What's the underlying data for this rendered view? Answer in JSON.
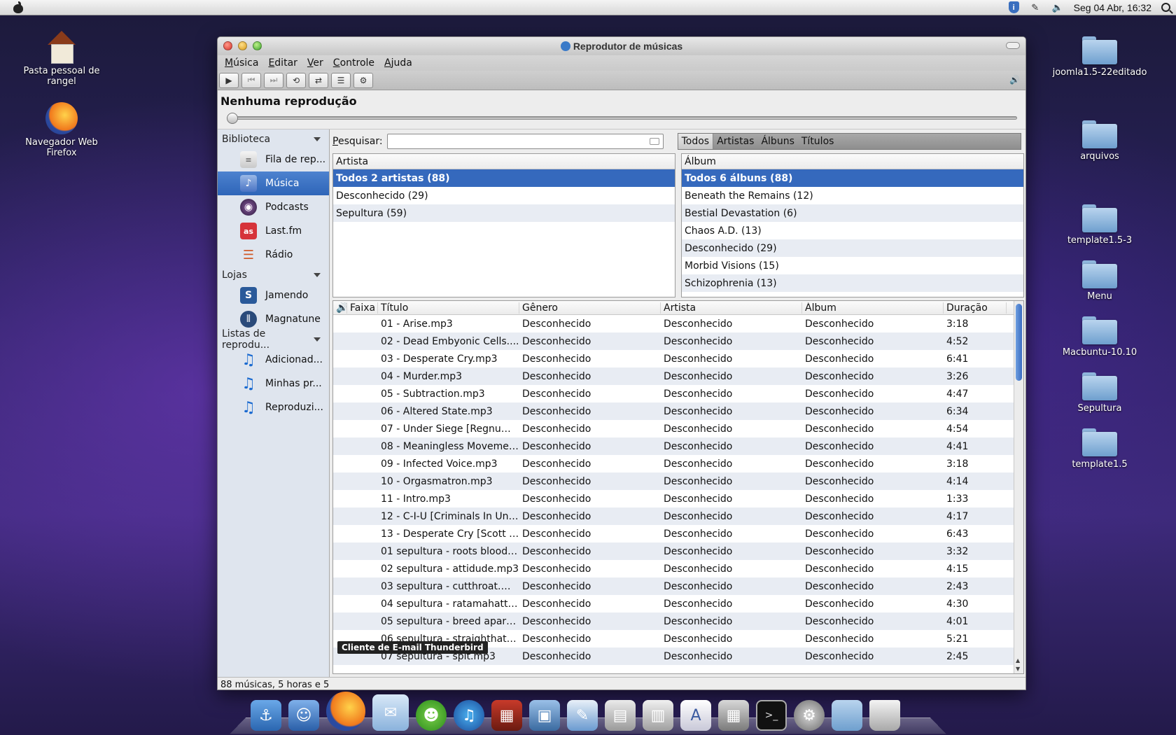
{
  "menubar": {
    "clock": "Seg 04 Abr, 16:32"
  },
  "desktop_left": [
    {
      "label": "Pasta pessoal de rangel",
      "icon": "home-folder-icon"
    },
    {
      "label": "Navegador Web Firefox",
      "icon": "firefox-icon"
    }
  ],
  "desktop_right": [
    {
      "label": "joomla1.5-22editado"
    },
    {
      "label": "arquivos"
    },
    {
      "label": "template1.5-3"
    },
    {
      "label": "Menu"
    },
    {
      "label": "Macbuntu-10.10"
    },
    {
      "label": "Sepultura"
    },
    {
      "label": "template1.5"
    }
  ],
  "window": {
    "title": "Reprodutor de músicas",
    "menus": [
      "Música",
      "Editar",
      "Ver",
      "Controle",
      "Ajuda"
    ],
    "now_playing": "Nenhuma reprodução",
    "seek_position": 0
  },
  "sidebar": {
    "sections": [
      {
        "title": "Biblioteca",
        "items": [
          {
            "label": "Fila de rep...",
            "icon": "queue-icon",
            "active": false
          },
          {
            "label": "Música",
            "icon": "music-library-icon",
            "active": true
          },
          {
            "label": "Podcasts",
            "icon": "podcast-icon",
            "active": false
          },
          {
            "label": "Last.fm",
            "icon": "lastfm-icon",
            "active": false
          },
          {
            "label": "Rádio",
            "icon": "radio-icon",
            "active": false
          }
        ]
      },
      {
        "title": "Lojas",
        "items": [
          {
            "label": "Jamendo",
            "icon": "jamendo-icon",
            "active": false
          },
          {
            "label": "Magnatune",
            "icon": "magnatune-icon",
            "active": false
          }
        ]
      },
      {
        "title": "Listas de reprodu...",
        "items": [
          {
            "label": "Adicionad...",
            "icon": "playlist-note-icon",
            "active": false
          },
          {
            "label": "Minhas pr...",
            "icon": "playlist-note-icon",
            "active": false
          },
          {
            "label": "Reproduzi...",
            "icon": "playlist-note-icon",
            "active": false
          }
        ]
      }
    ]
  },
  "search": {
    "label": "Pesquisar:",
    "value": "",
    "placeholder": ""
  },
  "filter_tabs": [
    {
      "label": "Todos",
      "active": true
    },
    {
      "label": "Artistas",
      "active": false
    },
    {
      "label": "Álbuns",
      "active": false
    },
    {
      "label": "Títulos",
      "active": false
    }
  ],
  "artist_pane": {
    "header": "Artista",
    "rows": [
      {
        "label": "Todos 2 artistas (88)",
        "selected": true
      },
      {
        "label": "Desconhecido (29)",
        "selected": false
      },
      {
        "label": "Sepultura (59)",
        "selected": false
      }
    ]
  },
  "album_pane": {
    "header": "Álbum",
    "rows": [
      {
        "label": "Todos 6 álbuns (88)",
        "selected": true
      },
      {
        "label": "Beneath the Remains (12)",
        "selected": false
      },
      {
        "label": "Bestial Devastation (6)",
        "selected": false
      },
      {
        "label": "Chaos A.D. (13)",
        "selected": false
      },
      {
        "label": "Desconhecido (29)",
        "selected": false
      },
      {
        "label": "Morbid Visions (15)",
        "selected": false
      },
      {
        "label": "Schizophrenia (13)",
        "selected": false
      }
    ]
  },
  "tracks": {
    "columns": [
      "Faixa",
      "Título",
      "Gênero",
      "Artista",
      "Álbum",
      "Duração"
    ],
    "rows": [
      {
        "title": "01 - Arise.mp3",
        "genre": "Desconhecido",
        "artist": "Desconhecido",
        "album": "Desconhecido",
        "duration": "3:18"
      },
      {
        "title": "02 - Dead Embyonic Cells....",
        "genre": "Desconhecido",
        "artist": "Desconhecido",
        "album": "Desconhecido",
        "duration": "4:52"
      },
      {
        "title": "03 - Desperate Cry.mp3",
        "genre": "Desconhecido",
        "artist": "Desconhecido",
        "album": "Desconhecido",
        "duration": "6:41"
      },
      {
        "title": "04 - Murder.mp3",
        "genre": "Desconhecido",
        "artist": "Desconhecido",
        "album": "Desconhecido",
        "duration": "3:26"
      },
      {
        "title": "05 - Subtraction.mp3",
        "genre": "Desconhecido",
        "artist": "Desconhecido",
        "album": "Desconhecido",
        "duration": "4:47"
      },
      {
        "title": "06 - Altered State.mp3",
        "genre": "Desconhecido",
        "artist": "Desconhecido",
        "album": "Desconhecido",
        "duration": "6:34"
      },
      {
        "title": "07 - Under Siege [Regnum I...",
        "genre": "Desconhecido",
        "artist": "Desconhecido",
        "album": "Desconhecido",
        "duration": "4:54"
      },
      {
        "title": "08 - Meaningless Movemen...",
        "genre": "Desconhecido",
        "artist": "Desconhecido",
        "album": "Desconhecido",
        "duration": "4:41"
      },
      {
        "title": "09 - Infected Voice.mp3",
        "genre": "Desconhecido",
        "artist": "Desconhecido",
        "album": "Desconhecido",
        "duration": "3:18"
      },
      {
        "title": "10 - Orgasmatron.mp3",
        "genre": "Desconhecido",
        "artist": "Desconhecido",
        "album": "Desconhecido",
        "duration": "4:14"
      },
      {
        "title": "11 - Intro.mp3",
        "genre": "Desconhecido",
        "artist": "Desconhecido",
        "album": "Desconhecido",
        "duration": "1:33"
      },
      {
        "title": "12 - C-I-U [Criminals In Unif...",
        "genre": "Desconhecido",
        "artist": "Desconhecido",
        "album": "Desconhecido",
        "duration": "4:17"
      },
      {
        "title": "13 - Desperate Cry [Scott B...",
        "genre": "Desconhecido",
        "artist": "Desconhecido",
        "album": "Desconhecido",
        "duration": "6:43"
      },
      {
        "title": "01 sepultura - roots bloody ...",
        "genre": "Desconhecido",
        "artist": "Desconhecido",
        "album": "Desconhecido",
        "duration": "3:32"
      },
      {
        "title": "02 sepultura - attidude.mp3",
        "genre": "Desconhecido",
        "artist": "Desconhecido",
        "album": "Desconhecido",
        "duration": "4:15"
      },
      {
        "title": "03 sepultura - cutthroat.mp3",
        "genre": "Desconhecido",
        "artist": "Desconhecido",
        "album": "Desconhecido",
        "duration": "2:43"
      },
      {
        "title": "04 sepultura - ratamahatta....",
        "genre": "Desconhecido",
        "artist": "Desconhecido",
        "album": "Desconhecido",
        "duration": "4:30"
      },
      {
        "title": "05 sepultura - breed apart....",
        "genre": "Desconhecido",
        "artist": "Desconhecido",
        "album": "Desconhecido",
        "duration": "4:01"
      },
      {
        "title": "06 sepultura - straighthate....",
        "genre": "Desconhecido",
        "artist": "Desconhecido",
        "album": "Desconhecido",
        "duration": "5:21"
      },
      {
        "title": "07 sepultura - spit.mp3",
        "genre": "Desconhecido",
        "artist": "Desconhecido",
        "album": "Desconhecido",
        "duration": "2:45"
      }
    ]
  },
  "status": "88 músicas, 5 horas e 5",
  "tooltip": "Cliente de E-mail Thunderbird",
  "dock": [
    {
      "name": "dock-anchor-icon",
      "glyph": "⚓"
    },
    {
      "name": "dock-finder-icon",
      "glyph": "☺"
    },
    {
      "name": "dock-firefox-icon",
      "glyph": ""
    },
    {
      "name": "dock-thunderbird-icon",
      "glyph": "✉"
    },
    {
      "name": "dock-pidgin-icon",
      "glyph": "☻"
    },
    {
      "name": "dock-itunes-icon",
      "glyph": "♫"
    },
    {
      "name": "dock-photo-booth-icon",
      "glyph": "▦"
    },
    {
      "name": "dock-image-viewer-icon",
      "glyph": "▣"
    },
    {
      "name": "dock-feather-icon",
      "glyph": "✎"
    },
    {
      "name": "dock-scanner-icon",
      "glyph": "▤"
    },
    {
      "name": "dock-printer-icon",
      "glyph": "▥"
    },
    {
      "name": "dock-document-icon",
      "glyph": "A"
    },
    {
      "name": "dock-calculator-icon",
      "glyph": "▦"
    },
    {
      "name": "dock-terminal-icon",
      "glyph": ">_"
    },
    {
      "name": "dock-system-prefs-icon",
      "glyph": "⚙"
    },
    {
      "name": "dock-folder-icon",
      "glyph": ""
    },
    {
      "name": "dock-trash-icon",
      "glyph": ""
    }
  ]
}
